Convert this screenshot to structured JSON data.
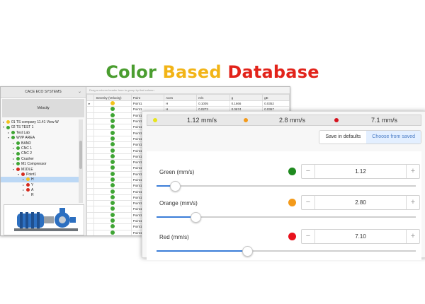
{
  "headline": {
    "word1": "Color",
    "word2": "Based",
    "word3": "Database"
  },
  "colors": {
    "green": "#4a9d2f",
    "yellow": "#f2b417",
    "red": "#e2231a",
    "accent": "#3b7dd8"
  },
  "back_window": {
    "pane_title": "CACE ECO SYSTEMS",
    "velocity_label": "Velocity",
    "grid_hint": "Drag a column header here to group by that column",
    "tree": [
      {
        "label": "01 TS company 11.41 View W",
        "icon": "yellow",
        "indent": 0,
        "expanded": false
      },
      {
        "label": "02 TS TEST 1",
        "icon": "green",
        "indent": 0,
        "expanded": true
      },
      {
        "label": "Test Lab",
        "icon": "green",
        "indent": 1,
        "expanded": false
      },
      {
        "label": "WVP AREA",
        "icon": "green",
        "indent": 1,
        "expanded": true
      },
      {
        "label": "BAND",
        "icon": "green",
        "indent": 2,
        "expanded": false
      },
      {
        "label": "CNC 1",
        "icon": "green",
        "indent": 2,
        "expanded": false
      },
      {
        "label": "CNC 2",
        "icon": "green",
        "indent": 2,
        "expanded": false
      },
      {
        "label": "Crusher",
        "icon": "green",
        "indent": 2,
        "expanded": false
      },
      {
        "label": "M1 Compressor",
        "icon": "green",
        "indent": 2,
        "expanded": false
      },
      {
        "label": "M1DLE",
        "icon": "red",
        "indent": 2,
        "expanded": true
      },
      {
        "label": "Point1",
        "icon": "red",
        "indent": 3,
        "expanded": true
      },
      {
        "label": "H",
        "icon": "yellow",
        "indent": 4,
        "expanded": false,
        "selected": true
      },
      {
        "label": "Y",
        "icon": "red",
        "indent": 4,
        "expanded": false
      },
      {
        "label": "A",
        "icon": "red",
        "indent": 4,
        "expanded": false
      },
      {
        "label": "R",
        "icon": "none",
        "indent": 4,
        "expanded": false
      }
    ],
    "grid": {
      "columns": [
        "Severity (Velocity)",
        "Point",
        "Axes",
        "m/s",
        "g",
        "gE"
      ],
      "rows": [
        {
          "sev": "yellow",
          "point": "Point1",
          "axes": "H",
          "ms": "0.1005",
          "g": "0.1666",
          "ge": "0.0352"
        },
        {
          "sev": "green",
          "point": "Point1",
          "axes": "H",
          "ms": "0.0273",
          "g": "0.0674",
          "ge": "0.0367"
        },
        {
          "sev": "green",
          "point": "Point1",
          "axes": "",
          "ms": "",
          "g": "",
          "ge": ""
        },
        {
          "sev": "green",
          "point": "Point1",
          "axes": "",
          "ms": "",
          "g": "",
          "ge": ""
        },
        {
          "sev": "green",
          "point": "Point1",
          "axes": "",
          "ms": "",
          "g": "",
          "ge": ""
        },
        {
          "sev": "green",
          "point": "Point1",
          "axes": "",
          "ms": "",
          "g": "",
          "ge": ""
        },
        {
          "sev": "green",
          "point": "Point1",
          "axes": "",
          "ms": "",
          "g": "",
          "ge": ""
        },
        {
          "sev": "green",
          "point": "Point1",
          "axes": "",
          "ms": "",
          "g": "",
          "ge": ""
        },
        {
          "sev": "green",
          "point": "Point1",
          "axes": "",
          "ms": "",
          "g": "",
          "ge": ""
        },
        {
          "sev": "green",
          "point": "Point1",
          "axes": "",
          "ms": "",
          "g": "",
          "ge": ""
        },
        {
          "sev": "green",
          "point": "Point1",
          "axes": "",
          "ms": "",
          "g": "",
          "ge": ""
        },
        {
          "sev": "green",
          "point": "Point1",
          "axes": "",
          "ms": "",
          "g": "",
          "ge": ""
        },
        {
          "sev": "green",
          "point": "Point1",
          "axes": "",
          "ms": "",
          "g": "",
          "ge": ""
        },
        {
          "sev": "green",
          "point": "Point1",
          "axes": "",
          "ms": "",
          "g": "",
          "ge": ""
        },
        {
          "sev": "green",
          "point": "Point1",
          "axes": "",
          "ms": "",
          "g": "",
          "ge": ""
        },
        {
          "sev": "green",
          "point": "Point1",
          "axes": "",
          "ms": "",
          "g": "",
          "ge": ""
        },
        {
          "sev": "green",
          "point": "Point1",
          "axes": "",
          "ms": "",
          "g": "",
          "ge": ""
        },
        {
          "sev": "green",
          "point": "Point1",
          "axes": "",
          "ms": "",
          "g": "",
          "ge": ""
        },
        {
          "sev": "green",
          "point": "Point1",
          "axes": "",
          "ms": "",
          "g": "",
          "ge": ""
        },
        {
          "sev": "green",
          "point": "Point1",
          "axes": "",
          "ms": "",
          "g": "",
          "ge": ""
        },
        {
          "sev": "green",
          "point": "Point1",
          "axes": "",
          "ms": "",
          "g": "",
          "ge": ""
        },
        {
          "sev": "green",
          "point": "Point1",
          "axes": "",
          "ms": "",
          "g": "",
          "ge": ""
        },
        {
          "sev": "green",
          "point": "Point1",
          "axes": "",
          "ms": "",
          "g": "",
          "ge": ""
        },
        {
          "sev": "green",
          "point": "Point1",
          "axes": "",
          "ms": "",
          "g": "",
          "ge": ""
        },
        {
          "sev": "green",
          "point": "Point1",
          "axes": "",
          "ms": "",
          "g": "",
          "ge": ""
        }
      ]
    }
  },
  "settings_panel": {
    "legend": [
      {
        "text": "1.12 mm/s",
        "color": "#e7e41c"
      },
      {
        "text": "2.8 mm/s",
        "color": "#f39a1a"
      },
      {
        "text": "7.1 mm/s",
        "color": "#d5111d"
      }
    ],
    "save_label": "Save in defaults",
    "choose_label": "Choose from saved",
    "minus_symbol": "−",
    "plus_symbol": "+",
    "thresholds": [
      {
        "key": "green",
        "label": "Green (mm/s)",
        "value": "1.12",
        "dot_color": "#1f8a1f",
        "level": 0.07
      },
      {
        "key": "orange",
        "label": "Orange (mm/s)",
        "value": "2.80",
        "dot_color": "#f39a1a",
        "level": 0.15
      },
      {
        "key": "red",
        "label": "Red (mm/s)",
        "value": "7.10",
        "dot_color": "#e8111d",
        "level": 0.35
      }
    ]
  }
}
